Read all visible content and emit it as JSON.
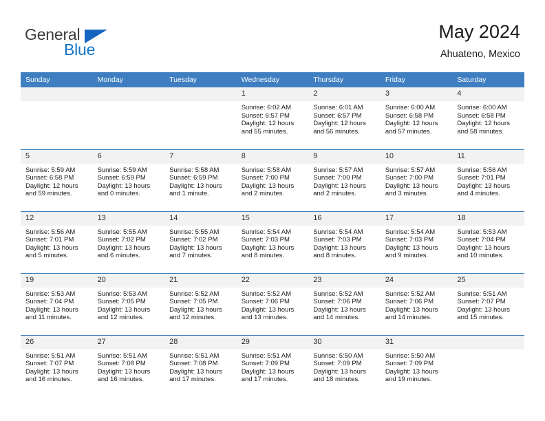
{
  "brand": {
    "name_part1": "General",
    "name_part2": "Blue",
    "triangle_color": "#1565c0",
    "blue_color": "#1274c4"
  },
  "header": {
    "title": "May 2024",
    "subtitle": "Ahuateno, Mexico"
  },
  "theme": {
    "header_bg": "#3f7fc1",
    "header_text": "#ffffff",
    "daynum_bg": "#f2f2f2",
    "row_divider": "#3f7fc1",
    "body_text": "#1a1a1a"
  },
  "weekday_headers": [
    "Sunday",
    "Monday",
    "Tuesday",
    "Wednesday",
    "Thursday",
    "Friday",
    "Saturday"
  ],
  "labels": {
    "sunrise_prefix": "Sunrise:",
    "sunset_prefix": "Sunset:",
    "daylight_prefix": "Daylight:"
  },
  "weeks": [
    [
      {
        "day": "",
        "empty": true
      },
      {
        "day": "",
        "empty": true
      },
      {
        "day": "",
        "empty": true
      },
      {
        "day": "1",
        "sunrise": "Sunrise: 6:02 AM",
        "sunset": "Sunset: 6:57 PM",
        "daylight_l1": "Daylight: 12 hours",
        "daylight_l2": "and 55 minutes."
      },
      {
        "day": "2",
        "sunrise": "Sunrise: 6:01 AM",
        "sunset": "Sunset: 6:57 PM",
        "daylight_l1": "Daylight: 12 hours",
        "daylight_l2": "and 56 minutes."
      },
      {
        "day": "3",
        "sunrise": "Sunrise: 6:00 AM",
        "sunset": "Sunset: 6:58 PM",
        "daylight_l1": "Daylight: 12 hours",
        "daylight_l2": "and 57 minutes."
      },
      {
        "day": "4",
        "sunrise": "Sunrise: 6:00 AM",
        "sunset": "Sunset: 6:58 PM",
        "daylight_l1": "Daylight: 12 hours",
        "daylight_l2": "and 58 minutes."
      }
    ],
    [
      {
        "day": "5",
        "sunrise": "Sunrise: 5:59 AM",
        "sunset": "Sunset: 6:58 PM",
        "daylight_l1": "Daylight: 12 hours",
        "daylight_l2": "and 59 minutes."
      },
      {
        "day": "6",
        "sunrise": "Sunrise: 5:59 AM",
        "sunset": "Sunset: 6:59 PM",
        "daylight_l1": "Daylight: 13 hours",
        "daylight_l2": "and 0 minutes."
      },
      {
        "day": "7",
        "sunrise": "Sunrise: 5:58 AM",
        "sunset": "Sunset: 6:59 PM",
        "daylight_l1": "Daylight: 13 hours",
        "daylight_l2": "and 1 minute."
      },
      {
        "day": "8",
        "sunrise": "Sunrise: 5:58 AM",
        "sunset": "Sunset: 7:00 PM",
        "daylight_l1": "Daylight: 13 hours",
        "daylight_l2": "and 2 minutes."
      },
      {
        "day": "9",
        "sunrise": "Sunrise: 5:57 AM",
        "sunset": "Sunset: 7:00 PM",
        "daylight_l1": "Daylight: 13 hours",
        "daylight_l2": "and 2 minutes."
      },
      {
        "day": "10",
        "sunrise": "Sunrise: 5:57 AM",
        "sunset": "Sunset: 7:00 PM",
        "daylight_l1": "Daylight: 13 hours",
        "daylight_l2": "and 3 minutes."
      },
      {
        "day": "11",
        "sunrise": "Sunrise: 5:56 AM",
        "sunset": "Sunset: 7:01 PM",
        "daylight_l1": "Daylight: 13 hours",
        "daylight_l2": "and 4 minutes."
      }
    ],
    [
      {
        "day": "12",
        "sunrise": "Sunrise: 5:56 AM",
        "sunset": "Sunset: 7:01 PM",
        "daylight_l1": "Daylight: 13 hours",
        "daylight_l2": "and 5 minutes."
      },
      {
        "day": "13",
        "sunrise": "Sunrise: 5:55 AM",
        "sunset": "Sunset: 7:02 PM",
        "daylight_l1": "Daylight: 13 hours",
        "daylight_l2": "and 6 minutes."
      },
      {
        "day": "14",
        "sunrise": "Sunrise: 5:55 AM",
        "sunset": "Sunset: 7:02 PM",
        "daylight_l1": "Daylight: 13 hours",
        "daylight_l2": "and 7 minutes."
      },
      {
        "day": "15",
        "sunrise": "Sunrise: 5:54 AM",
        "sunset": "Sunset: 7:03 PM",
        "daylight_l1": "Daylight: 13 hours",
        "daylight_l2": "and 8 minutes."
      },
      {
        "day": "16",
        "sunrise": "Sunrise: 5:54 AM",
        "sunset": "Sunset: 7:03 PM",
        "daylight_l1": "Daylight: 13 hours",
        "daylight_l2": "and 8 minutes."
      },
      {
        "day": "17",
        "sunrise": "Sunrise: 5:54 AM",
        "sunset": "Sunset: 7:03 PM",
        "daylight_l1": "Daylight: 13 hours",
        "daylight_l2": "and 9 minutes."
      },
      {
        "day": "18",
        "sunrise": "Sunrise: 5:53 AM",
        "sunset": "Sunset: 7:04 PM",
        "daylight_l1": "Daylight: 13 hours",
        "daylight_l2": "and 10 minutes."
      }
    ],
    [
      {
        "day": "19",
        "sunrise": "Sunrise: 5:53 AM",
        "sunset": "Sunset: 7:04 PM",
        "daylight_l1": "Daylight: 13 hours",
        "daylight_l2": "and 11 minutes."
      },
      {
        "day": "20",
        "sunrise": "Sunrise: 5:53 AM",
        "sunset": "Sunset: 7:05 PM",
        "daylight_l1": "Daylight: 13 hours",
        "daylight_l2": "and 12 minutes."
      },
      {
        "day": "21",
        "sunrise": "Sunrise: 5:52 AM",
        "sunset": "Sunset: 7:05 PM",
        "daylight_l1": "Daylight: 13 hours",
        "daylight_l2": "and 12 minutes."
      },
      {
        "day": "22",
        "sunrise": "Sunrise: 5:52 AM",
        "sunset": "Sunset: 7:06 PM",
        "daylight_l1": "Daylight: 13 hours",
        "daylight_l2": "and 13 minutes."
      },
      {
        "day": "23",
        "sunrise": "Sunrise: 5:52 AM",
        "sunset": "Sunset: 7:06 PM",
        "daylight_l1": "Daylight: 13 hours",
        "daylight_l2": "and 14 minutes."
      },
      {
        "day": "24",
        "sunrise": "Sunrise: 5:52 AM",
        "sunset": "Sunset: 7:06 PM",
        "daylight_l1": "Daylight: 13 hours",
        "daylight_l2": "and 14 minutes."
      },
      {
        "day": "25",
        "sunrise": "Sunrise: 5:51 AM",
        "sunset": "Sunset: 7:07 PM",
        "daylight_l1": "Daylight: 13 hours",
        "daylight_l2": "and 15 minutes."
      }
    ],
    [
      {
        "day": "26",
        "sunrise": "Sunrise: 5:51 AM",
        "sunset": "Sunset: 7:07 PM",
        "daylight_l1": "Daylight: 13 hours",
        "daylight_l2": "and 16 minutes."
      },
      {
        "day": "27",
        "sunrise": "Sunrise: 5:51 AM",
        "sunset": "Sunset: 7:08 PM",
        "daylight_l1": "Daylight: 13 hours",
        "daylight_l2": "and 16 minutes."
      },
      {
        "day": "28",
        "sunrise": "Sunrise: 5:51 AM",
        "sunset": "Sunset: 7:08 PM",
        "daylight_l1": "Daylight: 13 hours",
        "daylight_l2": "and 17 minutes."
      },
      {
        "day": "29",
        "sunrise": "Sunrise: 5:51 AM",
        "sunset": "Sunset: 7:09 PM",
        "daylight_l1": "Daylight: 13 hours",
        "daylight_l2": "and 17 minutes."
      },
      {
        "day": "30",
        "sunrise": "Sunrise: 5:50 AM",
        "sunset": "Sunset: 7:09 PM",
        "daylight_l1": "Daylight: 13 hours",
        "daylight_l2": "and 18 minutes."
      },
      {
        "day": "31",
        "sunrise": "Sunrise: 5:50 AM",
        "sunset": "Sunset: 7:09 PM",
        "daylight_l1": "Daylight: 13 hours",
        "daylight_l2": "and 19 minutes."
      },
      {
        "day": "",
        "empty": true
      }
    ]
  ]
}
